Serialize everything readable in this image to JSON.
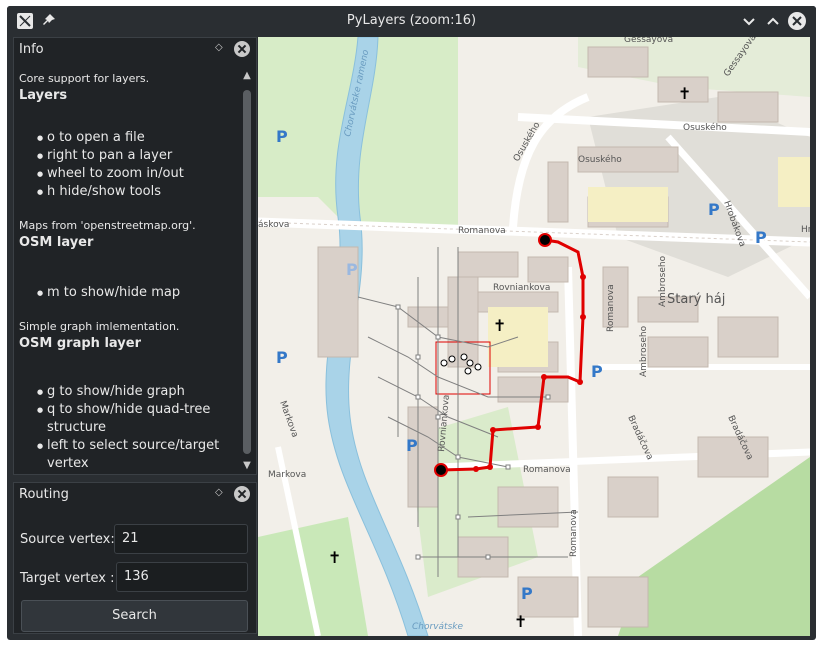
{
  "window": {
    "title": "PyLayers (zoom:16)"
  },
  "info_panel": {
    "title": "Info",
    "sections": [
      {
        "subtitle": "Core support for layers.",
        "heading": "Layers",
        "items": [
          "o to open a file",
          "right to pan a layer",
          "wheel to zoom in/out",
          "h hide/show tools"
        ]
      },
      {
        "subtitle": "Maps from 'openstreetmap.org'.",
        "heading": "OSM layer",
        "items": [
          "m to show/hide map"
        ]
      },
      {
        "subtitle": "Simple graph imlementation.",
        "heading": "OSM graph layer",
        "items": [
          "g to show/hide graph",
          "q to show/hide quad-tree structure",
          "left to select source/target vertex"
        ]
      }
    ]
  },
  "routing_panel": {
    "title": "Routing",
    "source_label": "Source vertex:",
    "source_value": "21",
    "target_label": "Target vertex :",
    "target_value": "136",
    "search_label": "Search"
  },
  "map": {
    "street_labels": {
      "gessayova_top": "Gessayova",
      "gessayova_right": "Gessayova",
      "osuskeho_right": "Osuského",
      "osuskeho_mid": "Osuského",
      "osuskeho_lower": "Osuského",
      "romanova_top": "Romanova",
      "romanova_vertical": "Romanova",
      "romanova_bottom": "Romanova",
      "romanova_far": "Romanova",
      "rovniankova": "Rovniankova",
      "rovniankova_vertical": "Rovniankova",
      "markova_vertical": "Markova",
      "markova": "Markova",
      "chorvatske_rameno": "Chorvátske rameno",
      "chorvatske_bottom": "Chorvátske",
      "askova": "áskova",
      "hrobakova": "Hrobákova",
      "hrobakova_edge": "Hro",
      "ambroseho": "Ambroseho",
      "ambroseho_lower": "Ambroseho",
      "bradacova": "Bradáčova",
      "bradacova_right": "Bradáčova",
      "stary_haj": "Starý háj"
    },
    "colors": {
      "route": "#e00000",
      "river": "#a9d3e8",
      "park": "#c9e8b8",
      "road": "#ffffff",
      "building": "#d9d0c9",
      "parking": "#3478c8"
    }
  }
}
